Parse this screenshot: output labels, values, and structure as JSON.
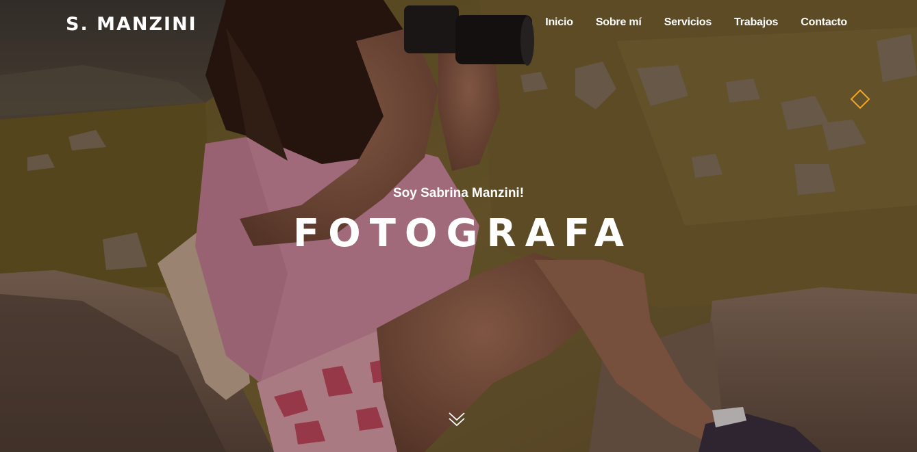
{
  "header": {
    "logo": "S. MANZINI"
  },
  "nav": {
    "items": [
      {
        "label": "Inicio"
      },
      {
        "label": "Sobre mí"
      },
      {
        "label": "Servicios"
      },
      {
        "label": "Trabajos"
      },
      {
        "label": "Contacto"
      }
    ]
  },
  "hero": {
    "subtitle": "Soy Sabrina Manzini!",
    "title": "FOTOGRAFA"
  },
  "colors": {
    "accent": "#f5a623",
    "text": "#ffffff"
  },
  "icons": {
    "decoration": "diamond-outline-icon",
    "scroll": "double-chevron-down-icon"
  }
}
